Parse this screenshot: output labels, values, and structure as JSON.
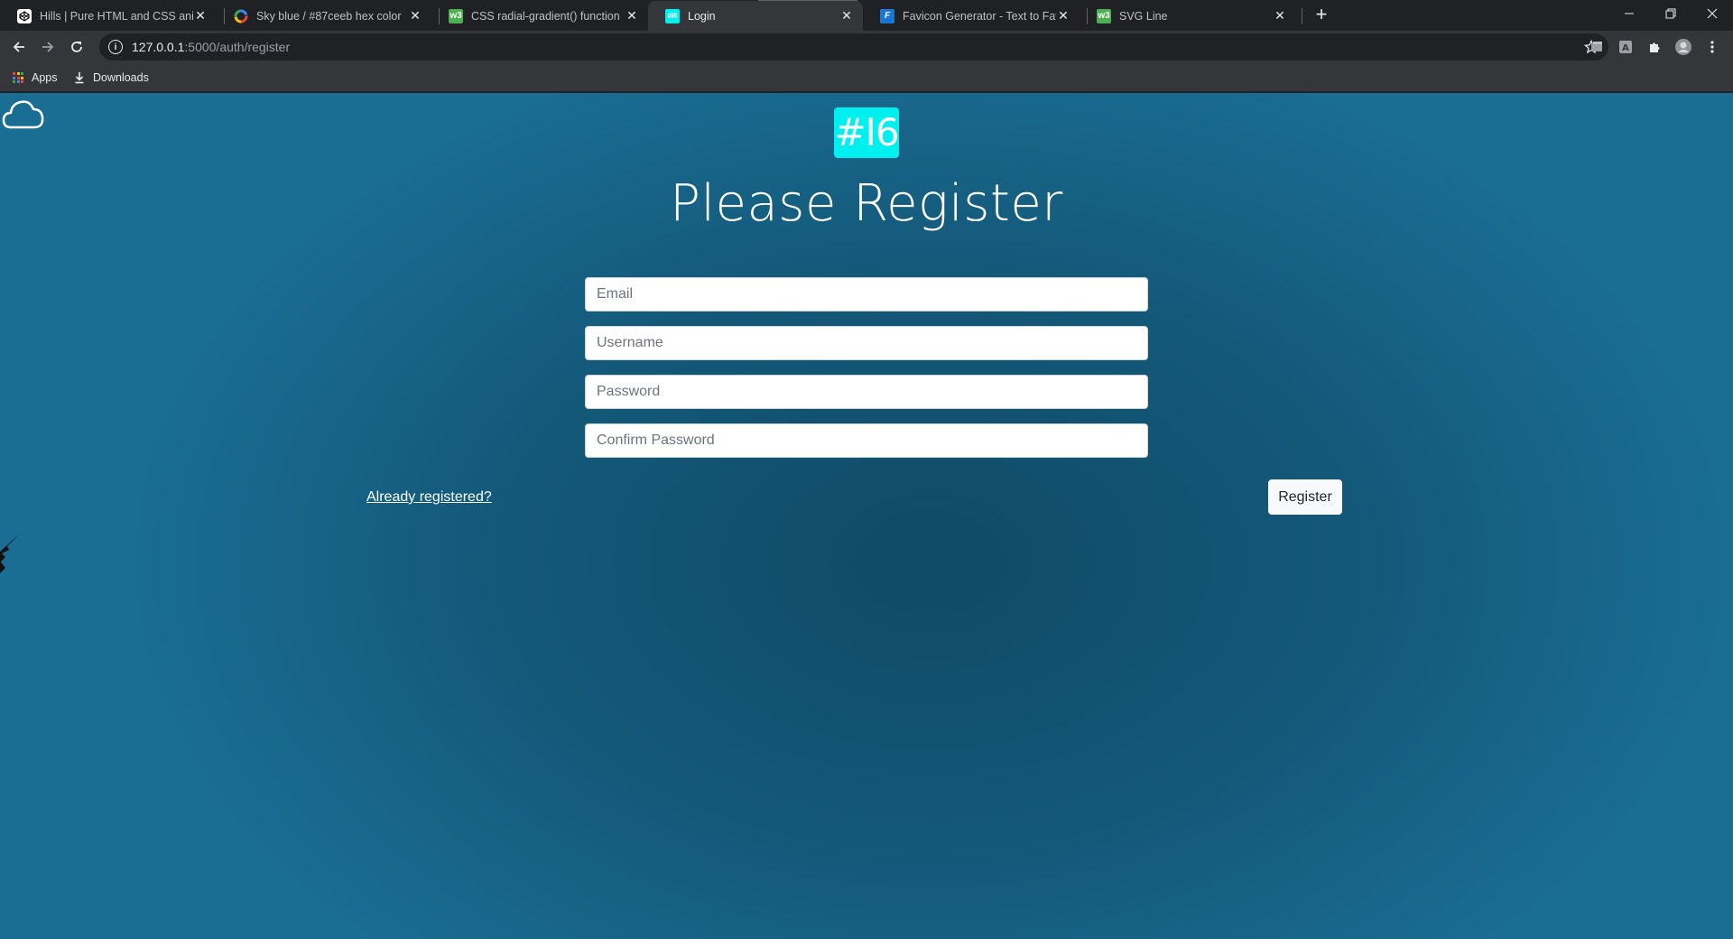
{
  "browser": {
    "tabs": [
      {
        "title": "Hills | Pure HTML and CSS anima",
        "favicon": "codepen-icon",
        "active": false
      },
      {
        "title": "Sky blue / #87ceeb hex color",
        "favicon": "colorhexa-icon",
        "active": false
      },
      {
        "title": "CSS radial-gradient() function",
        "favicon": "w3schools-icon",
        "active": false
      },
      {
        "title": "Login",
        "favicon": "site-favicon",
        "active": true
      },
      {
        "title": "Favicon Generator - Text to Favic",
        "favicon": "favicon-io-icon",
        "active": false
      },
      {
        "title": "SVG Line",
        "favicon": "w3schools-icon",
        "active": false
      }
    ],
    "url_host": "127.0.0.1",
    "url_path": ":5000/auth/register",
    "bookmarks": [
      {
        "label": "Apps",
        "icon": "apps-grid-icon"
      },
      {
        "label": "Downloads",
        "icon": "download-icon"
      }
    ],
    "colors": {
      "tab_strip": "#202124",
      "toolbar": "#35363a",
      "omnibox": "#202124"
    }
  },
  "page": {
    "logo_text": "#I6",
    "heading": "Please Register",
    "fields": {
      "email_placeholder": "Email",
      "username_placeholder": "Username",
      "password_placeholder": "Password",
      "confirm_placeholder": "Confirm Password"
    },
    "already_registered_link": "Already registered?",
    "register_button": "Register",
    "colors": {
      "logo_bg": "#00f0f0",
      "background": "#14597a",
      "background_center": "#0f4a66",
      "text": "#ffffff"
    }
  }
}
